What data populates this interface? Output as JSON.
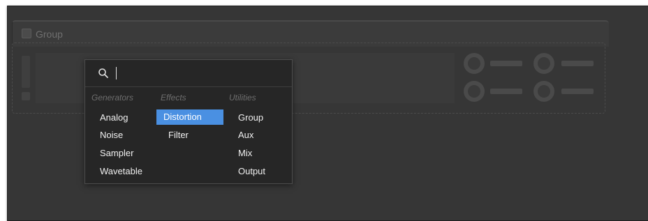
{
  "group": {
    "title": "Group"
  },
  "search": {
    "placeholder": "",
    "value": ""
  },
  "columns": [
    {
      "header": "Generators",
      "items": [
        "Analog",
        "Noise",
        "Sampler",
        "Wavetable"
      ]
    },
    {
      "header": "Effects",
      "items": [
        "Distortion",
        "Filter"
      ]
    },
    {
      "header": "Utilities",
      "items": [
        "Group",
        "Aux",
        "Mix",
        "Output"
      ]
    }
  ],
  "selected_item": "Distortion",
  "colors": {
    "background": "#363636",
    "popup": "#262626",
    "selection": "#4a90e2"
  }
}
